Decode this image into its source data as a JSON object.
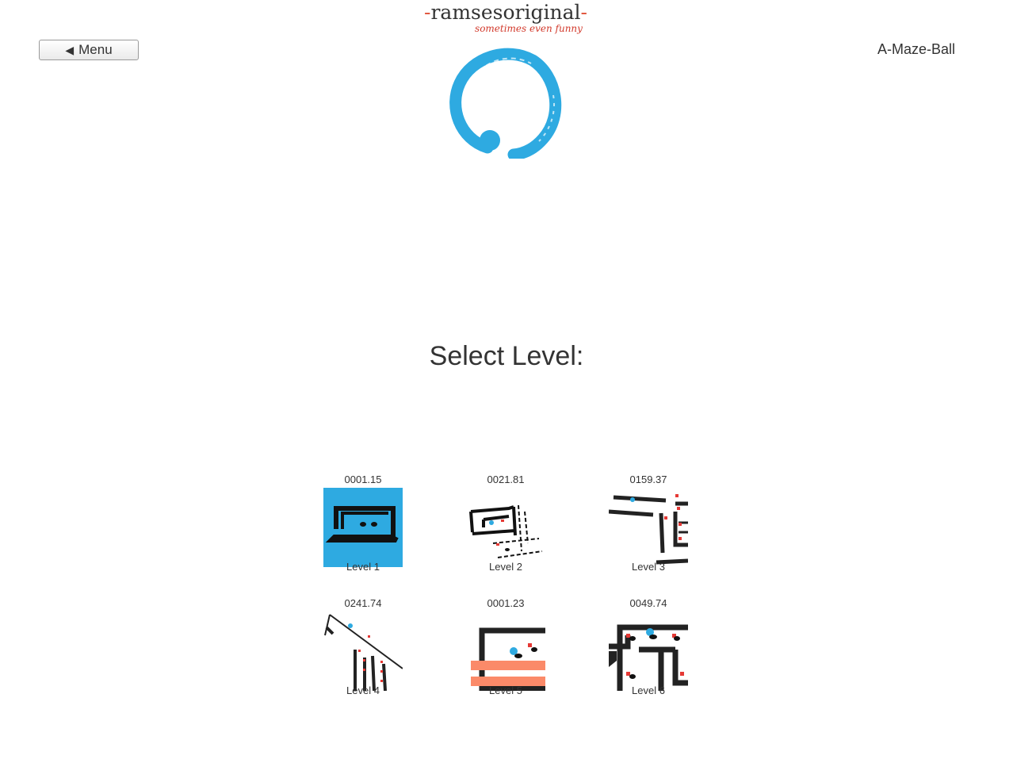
{
  "header": {
    "menu_label": "Menu",
    "menu_icon": "triangle-left-icon",
    "brand_name": "ramsesoriginal",
    "brand_dash": "-",
    "brand_tagline": "sometimes even funny",
    "app_title": "A-Maze-Ball",
    "accent_color": "#e0533a",
    "logo_color": "#2eaae1"
  },
  "main": {
    "heading": "Select Level:",
    "levels": [
      {
        "name": "Level 1",
        "time": "0001.15"
      },
      {
        "name": "Level 2",
        "time": "0021.81"
      },
      {
        "name": "Level 3",
        "time": "0159.37"
      },
      {
        "name": "Level 4",
        "time": "0241.74"
      },
      {
        "name": "Level 5",
        "time": "0001.23"
      },
      {
        "name": "Level 6",
        "time": "0049.74"
      }
    ]
  }
}
